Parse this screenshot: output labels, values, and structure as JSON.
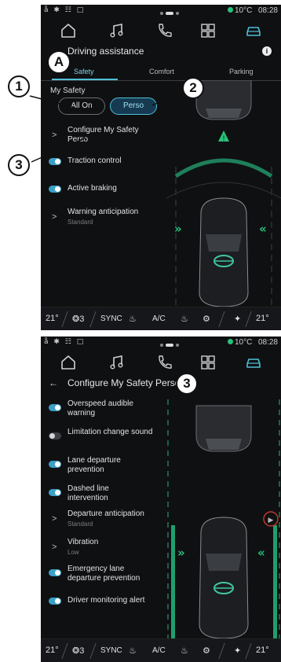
{
  "status": {
    "left_icons": "å ✱ ☷ □",
    "temperature": "10°C",
    "time": "08:28"
  },
  "callouts": {
    "a": "A",
    "one": "1",
    "two": "2",
    "three_top": "3",
    "three_bottom": "3"
  },
  "screen1": {
    "title": "Driving assistance",
    "tabs": [
      "Safety",
      "Comfort",
      "Parking"
    ],
    "section_label": "My Safety",
    "all_on_label": "All On",
    "perso_label": "Perso",
    "items": [
      {
        "type": "link",
        "title": "Configure My Safety Perso",
        "sub": ""
      },
      {
        "type": "toggle",
        "on": true,
        "title": "Traction control",
        "sub": ""
      },
      {
        "type": "toggle",
        "on": true,
        "title": "Active braking",
        "sub": ""
      },
      {
        "type": "link",
        "title": "Warning anticipation",
        "sub": "Standard"
      }
    ]
  },
  "screen2": {
    "title": "Configure My Safety Perso",
    "items": [
      {
        "type": "toggle",
        "on": true,
        "title": "Overspeed audible warning",
        "sub": ""
      },
      {
        "type": "toggle",
        "on": false,
        "title": "Limitation change sound",
        "sub": ""
      },
      {
        "type": "toggle",
        "on": true,
        "title": "Lane departure prevention",
        "sub": ""
      },
      {
        "type": "toggle",
        "on": true,
        "title": "Dashed line intervention",
        "sub": ""
      },
      {
        "type": "link",
        "title": "Departure anticipation",
        "sub": "Standard"
      },
      {
        "type": "link",
        "title": "Vibration",
        "sub": "Low"
      },
      {
        "type": "toggle",
        "on": true,
        "title": "Emergency lane departure prevention",
        "sub": ""
      },
      {
        "type": "toggle",
        "on": true,
        "title": "Driver monitoring alert",
        "sub": ""
      }
    ]
  },
  "climate": {
    "left_temp": "21°",
    "fan": "3",
    "sync": "SYNC",
    "ac": "A/C",
    "right_temp": "21°"
  },
  "colors": {
    "accent": "#4fc0d6",
    "screen_bg": "#0f1012",
    "guide_green": "#27c27a"
  },
  "icons": [
    "home-icon",
    "music-icon",
    "phone-icon",
    "apps-icon",
    "car-icon"
  ]
}
